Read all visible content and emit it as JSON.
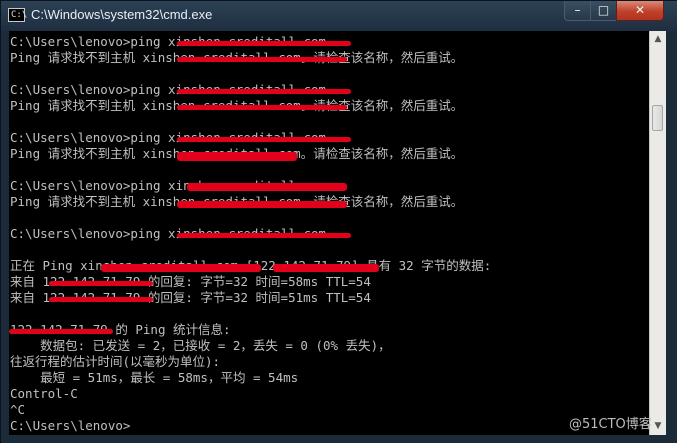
{
  "window": {
    "title": "C:\\Windows\\system32\\cmd.exe",
    "icon_label": "C:\\",
    "buttons": {
      "minimize": "–",
      "maximize": "□",
      "close": "✕"
    }
  },
  "console": {
    "lines": [
      "C:\\Users\\lenovo>ping xinshen.creditall.com",
      "Ping 请求找不到主机 xinshen.creditall.com。请检查该名称，然后重试。",
      "",
      "C:\\Users\\lenovo>ping xinshen.creditall.com",
      "Ping 请求找不到主机 xinshen.creditall.com。请检查该名称，然后重试。",
      "",
      "C:\\Users\\lenovo>ping xinshen.creditall.com",
      "Ping 请求找不到主机 xinshen.creditall.com。请检查该名称，然后重试。",
      "",
      "C:\\Users\\lenovo>ping xinshen.creditall.com",
      "Ping 请求找不到主机 xinshen.creditall.com。请检查该名称，然后重试。",
      "",
      "C:\\Users\\lenovo>ping xinshen.creditall.com",
      "",
      "正在 Ping xinshen.creditall.com [122.142.71.79] 具有 32 字节的数据:",
      "来自 122.142.71.79 的回复: 字节=32 时间=58ms TTL=54",
      "来自 122.142.71.79 的回复: 字节=32 时间=51ms TTL=54",
      "",
      "122.142.71.79 的 Ping 统计信息:",
      "    数据包: 已发送 = 2，已接收 = 2，丢失 = 0 (0% 丢失)，",
      "往返行程的估计时间(以毫秒为单位):",
      "    最短 = 51ms，最长 = 58ms，平均 = 54ms",
      "Control-C",
      "^C",
      "C:\\Users\\lenovo>"
    ]
  },
  "scrollbar": {
    "up_arrow": "▲",
    "down_arrow": "▼",
    "position_fraction": 0.18
  },
  "watermark": "@51CTO博客",
  "colors": {
    "console_bg": "#000000",
    "console_text": "#c0c0c0",
    "frame": "#1c2b3a",
    "redaction": "#e3001b"
  }
}
